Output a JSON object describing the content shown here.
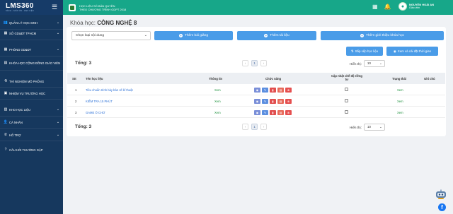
{
  "brand": {
    "logo_text": "LMS360",
    "tagline": "SÁCH - GIÁO ÁN - HỌC LIỆU"
  },
  "publisher": {
    "line1": "HỌC LIỆU SỐ BẢN QUYỀN",
    "line2": "THEO CHƯƠNG TRÌNH GDPT 2018"
  },
  "user": {
    "name": "NGUYỄN HOÀI AN",
    "role": "Giáo viên"
  },
  "sidebar": {
    "items": [
      {
        "label": "QUẢN LÝ HỌC SINH",
        "icon": "users-icon",
        "chevron": true
      },
      {
        "label": "SỞ GD&ĐT TPHCM",
        "icon": "grid-icon",
        "chevron": true
      },
      {
        "label": "PHÒNG GD&ĐT",
        "icon": "grid-icon",
        "chevron": true
      },
      {
        "label": "KHÓA HỌC CỘNG ĐỒNG GIÁO VIÊN",
        "icon": "book-icon",
        "chevron": false
      },
      {
        "label": "THÍ NGHIỆM MÔ PHỎNG",
        "icon": "flask-icon",
        "chevron": false
      },
      {
        "label": "NHIỆM VỤ TRƯỜNG HỌC",
        "icon": "clipboard-icon",
        "chevron": false
      },
      {
        "label": "KHO HỌC LIỆU",
        "icon": "folder-icon",
        "chevron": true
      },
      {
        "label": "CÁ NHÂN",
        "icon": "user-icon",
        "chevron": true
      },
      {
        "label": "HỖ TRỢ",
        "icon": "support-icon",
        "chevron": true
      },
      {
        "label": "CÂU HỎI THƯỜNG GẶP",
        "icon": "question-icon",
        "chevron": false
      }
    ]
  },
  "page": {
    "title_prefix": "Khóa học:",
    "title_value": "CÔNG NGHỆ 8"
  },
  "toolbar": {
    "select_placeholder": "Chọn loại nội dung",
    "add_lesson": "Thêm bài giảng",
    "add_material": "Thêm tài liệu",
    "add_intro": "Thêm giới thiệu khóa học",
    "sort_lessons": "Sắp xếp học liệu",
    "view_schedule": "Xem và cài đặt thời gian"
  },
  "summary": {
    "total_label": "Tổng: 3",
    "page_current": "1",
    "prev": "‹",
    "next": "›",
    "per_page_label": "Hiển thị:",
    "per_page_value": "10"
  },
  "table": {
    "headers": [
      "Stt",
      "Tên học liệu",
      "Thông tin",
      "Chức năng",
      "Cập nhật chế độ riêng tư",
      "Trạng thái",
      "Ghi chú"
    ],
    "rows": [
      {
        "stt": "1",
        "name": "Tiêu chuẩn trình bày bản vẽ kĩ thuật",
        "info": "Xem",
        "status": "Xem"
      },
      {
        "stt": "2",
        "name": "KIỂM TRA 15 PHÚT",
        "info": "Xem",
        "status": "Xem"
      },
      {
        "stt": "3",
        "name": "GAME Ô CHỮ",
        "info": "Xem",
        "status": "Xem"
      }
    ]
  },
  "colors": {
    "topbar": "#17a789",
    "sidebar": "#16385e",
    "button": "#4a9ce8",
    "link": "#2a6fd6",
    "green": "#1a8f3a"
  }
}
